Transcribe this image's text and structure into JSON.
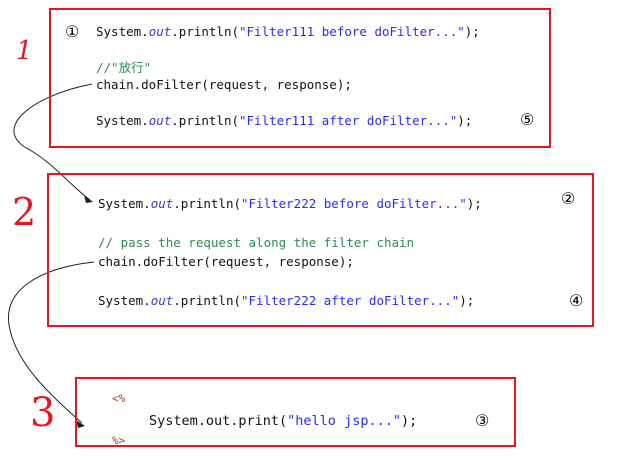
{
  "box1": {
    "step_marker_top": "①",
    "line1_pre": "System.",
    "line1_out": "out",
    "line1_post": ".println(",
    "line1_str": "\"Filter111 before doFilter...\"",
    "line1_end": ");",
    "comment": "//\"放行\"",
    "chain_call": "chain.doFilter(request, response);",
    "line3_pre": "System.",
    "line3_out": "out",
    "line3_post": ".println(",
    "line3_str": "\"Filter111 after doFilter...\"",
    "line3_end": ");",
    "step_marker_bottom": "⑤"
  },
  "box2": {
    "line1_pre": "System.",
    "line1_out": "out",
    "line1_post": ".println(",
    "line1_str": "\"Filter222 before doFilter...\"",
    "line1_end": ");",
    "step_marker_top": "②",
    "comment": "// pass the request along the filter chain",
    "chain_call": "chain.doFilter(request, response);",
    "line3_pre": "System.",
    "line3_out": "out",
    "line3_post": ".println(",
    "line3_str": "\"Filter222 after doFilter...\"",
    "line3_end": ");",
    "step_marker_bottom": "④"
  },
  "box3": {
    "open_tag": "<%",
    "code": "System.out.print(",
    "code_str": "\"hello jsp...\"",
    "code_end": ");",
    "step_marker": "③",
    "close_tag": "%>"
  },
  "handwritten_labels": [
    "1",
    "2",
    "3"
  ],
  "colors": {
    "box_border": "#e8161a",
    "string": "#2a2aff",
    "comment": "#2e8b57",
    "jsp_tag": "#b03a1a"
  }
}
